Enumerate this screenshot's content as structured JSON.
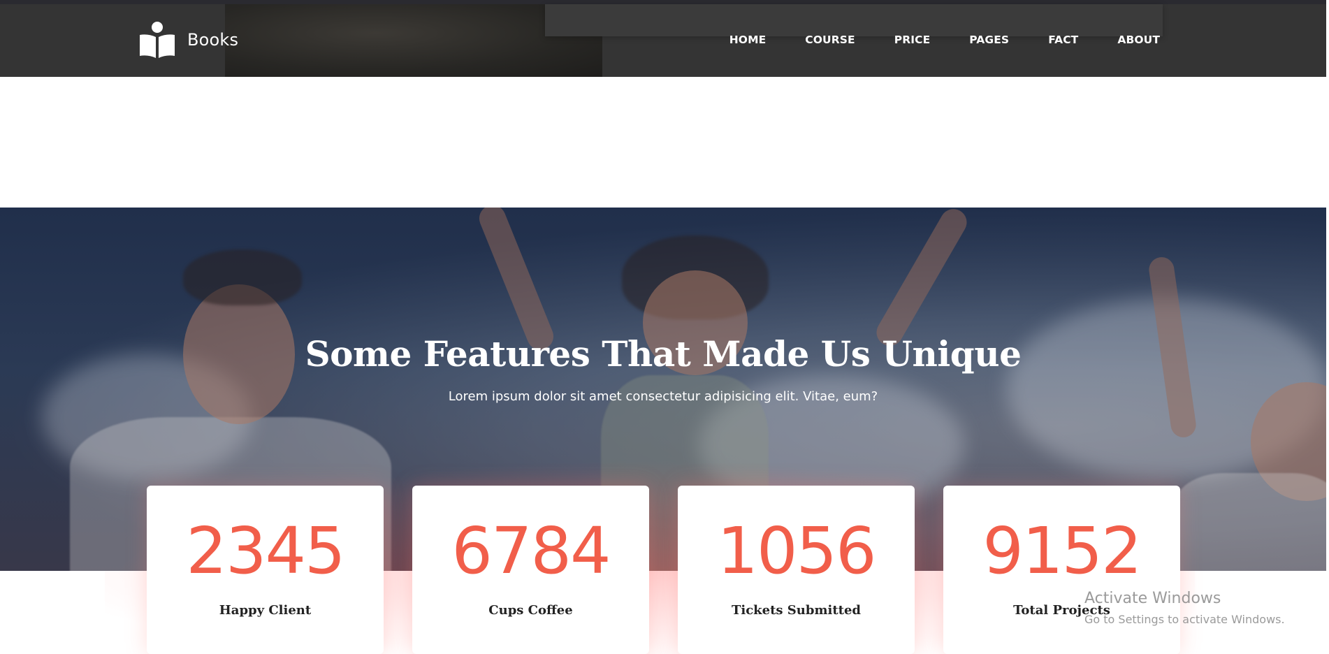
{
  "brand": {
    "name": "Books",
    "icon": "book-reader-icon"
  },
  "nav": {
    "items": [
      {
        "label": "HOME"
      },
      {
        "label": "COURSE"
      },
      {
        "label": "PRICE"
      },
      {
        "label": "PAGES"
      },
      {
        "label": "FACT"
      },
      {
        "label": "ABOUT"
      }
    ]
  },
  "hero": {
    "title": "Some Features That Made Us Unique",
    "subtitle": "Lorem ipsum dolor sit amet consectetur adipisicing elit. Vitae, eum?"
  },
  "stats": [
    {
      "value": "2345",
      "label": "Happy Client"
    },
    {
      "value": "6784",
      "label": "Cups Coffee"
    },
    {
      "value": "1056",
      "label": "Tickets Submitted"
    },
    {
      "value": "9152",
      "label": "Total Projects"
    }
  ],
  "watermark": {
    "line1": "Activate Windows",
    "line2": "Go to Settings to activate Windows."
  },
  "colors": {
    "navbar_bg": "#343434",
    "accent": "#f15e4a",
    "card_bg": "#ffffff"
  }
}
